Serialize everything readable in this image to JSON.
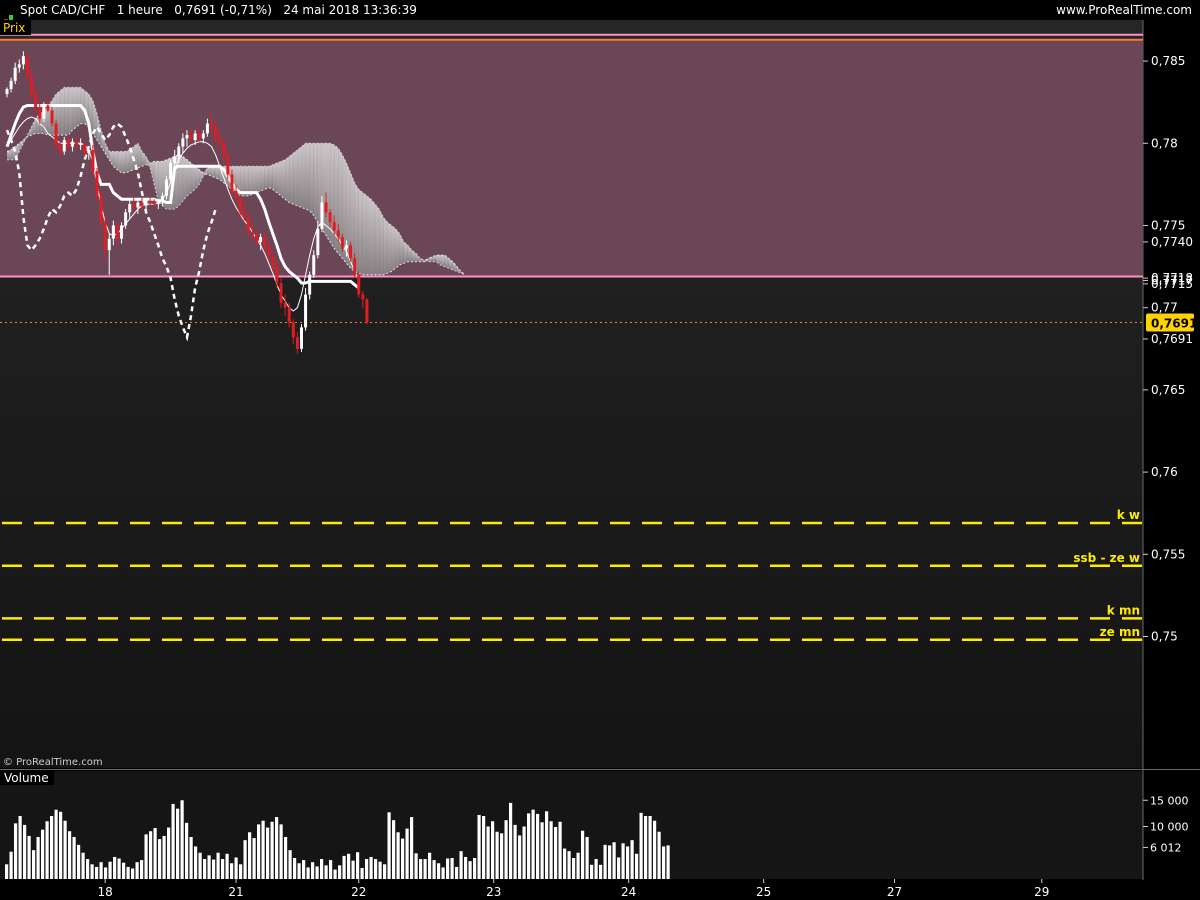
{
  "header": {
    "title": "Spot CAD/CHF   1 heure   0,7691 (-0,71%)   24 mai 2018 13:36:39",
    "site": "www.ProRealTime.com"
  },
  "panels": {
    "price_label": "Prix",
    "volume_label": "Volume",
    "watermark": "© ProRealTime.com"
  },
  "colors": {
    "up": "#ffffff",
    "down": "#e01c24",
    "zone_fill": "#6b4657",
    "orange": "#ff7a2a",
    "pink": "#ff8fc8",
    "yellow": "#ffea00",
    "last_price_bg": "#ffd200"
  },
  "chart_data": {
    "type": "candlestick",
    "instrument": "Spot CAD/CHF",
    "timeframe": "1 heure",
    "y_range": [
      0.742,
      0.7875
    ],
    "y_ticks": [
      "0,785",
      "0,78",
      "0,775",
      "0,77",
      "0,765",
      "0,76",
      "0,755",
      "0,75"
    ],
    "y_tick_values": [
      0.785,
      0.78,
      0.775,
      0.77,
      0.765,
      0.76,
      0.755,
      0.75
    ],
    "x_ticks": [
      "18",
      "21",
      "22",
      "23",
      "24",
      "25",
      "27",
      "29"
    ],
    "x_tick_index": [
      24,
      56,
      86,
      119,
      152,
      185,
      217,
      253
    ],
    "last_price": 0.7691,
    "last_price_label": "0,7691",
    "right_markers": [
      {
        "label": "0,7740",
        "value": 0.774
      },
      {
        "label": "0,7718",
        "value": 0.7718
      },
      {
        "label": "0,7717",
        "value": 0.77165
      },
      {
        "label": "0,7715",
        "value": 0.77145
      },
      {
        "label": "0,7691",
        "value": 0.7681
      }
    ],
    "zone": {
      "top": 0.7863,
      "bottom": 0.7719
    },
    "horizontal_lines": [
      {
        "value": 0.7877,
        "color": "orange",
        "style": "solid"
      },
      {
        "value": 0.7866,
        "color": "pink",
        "style": "solid"
      },
      {
        "value": 0.7863,
        "color": "orange",
        "style": "solid"
      },
      {
        "value": 0.7719,
        "color": "pink",
        "style": "solid"
      },
      {
        "value": 0.7691,
        "color": "orange",
        "style": "dotted"
      }
    ],
    "yellow_levels": [
      {
        "label": "k w",
        "value": 0.7569
      },
      {
        "label": "ssb - ze w",
        "value": 0.7543
      },
      {
        "label": "k mn",
        "value": 0.7511
      },
      {
        "label": "ze mn",
        "value": 0.7498
      }
    ],
    "ohlc": [
      [
        0.783,
        0.7834,
        0.7828,
        0.7833
      ],
      [
        0.7833,
        0.784,
        0.7831,
        0.7838
      ],
      [
        0.7838,
        0.7849,
        0.7836,
        0.7846
      ],
      [
        0.7846,
        0.7851,
        0.7843,
        0.7848
      ],
      [
        0.7848,
        0.7856,
        0.7845,
        0.7853
      ],
      [
        0.7853,
        0.7854,
        0.7838,
        0.7841
      ],
      [
        0.7841,
        0.7845,
        0.7827,
        0.783
      ],
      [
        0.783,
        0.7834,
        0.7818,
        0.7822
      ],
      [
        0.7822,
        0.7826,
        0.7812,
        0.7815
      ],
      [
        0.7815,
        0.7825,
        0.7813,
        0.7823
      ],
      [
        0.7823,
        0.7828,
        0.7819,
        0.782
      ],
      [
        0.782,
        0.7822,
        0.781,
        0.7812
      ],
      [
        0.7812,
        0.7814,
        0.7796,
        0.7799
      ],
      [
        0.7799,
        0.7802,
        0.7792,
        0.7795
      ],
      [
        0.7795,
        0.7804,
        0.7793,
        0.7802
      ],
      [
        0.7802,
        0.7806,
        0.7796,
        0.7798
      ],
      [
        0.7798,
        0.7803,
        0.7795,
        0.7801
      ],
      [
        0.7801,
        0.7804,
        0.7797,
        0.7799
      ],
      [
        0.7799,
        0.7803,
        0.7796,
        0.78
      ],
      [
        0.78,
        0.7801,
        0.7792,
        0.7794
      ],
      [
        0.7794,
        0.7798,
        0.779,
        0.7796
      ],
      [
        0.7796,
        0.7799,
        0.778,
        0.7783
      ],
      [
        0.7783,
        0.7785,
        0.7765,
        0.7768
      ],
      [
        0.7768,
        0.7771,
        0.7748,
        0.7752
      ],
      [
        0.7752,
        0.7756,
        0.773,
        0.7735
      ],
      [
        0.7735,
        0.7745,
        0.772,
        0.7742
      ],
      [
        0.7742,
        0.7753,
        0.7738,
        0.775
      ],
      [
        0.775,
        0.7752,
        0.7738,
        0.7742
      ],
      [
        0.7742,
        0.7752,
        0.7739,
        0.775
      ],
      [
        0.775,
        0.776,
        0.7748,
        0.7758
      ],
      [
        0.7758,
        0.7766,
        0.7754,
        0.7763
      ],
      [
        0.7763,
        0.7767,
        0.7758,
        0.7761
      ],
      [
        0.7761,
        0.7766,
        0.7757,
        0.7764
      ],
      [
        0.7764,
        0.7768,
        0.776,
        0.7762
      ],
      [
        0.7762,
        0.7766,
        0.7758,
        0.7765
      ],
      [
        0.7765,
        0.7768,
        0.7762,
        0.7764
      ],
      [
        0.7764,
        0.7766,
        0.7761,
        0.7763
      ],
      [
        0.7763,
        0.7765,
        0.776,
        0.7764
      ],
      [
        0.7764,
        0.777,
        0.7762,
        0.7768
      ],
      [
        0.7768,
        0.778,
        0.7766,
        0.7778
      ],
      [
        0.7778,
        0.779,
        0.7776,
        0.7788
      ],
      [
        0.7788,
        0.7796,
        0.7785,
        0.7792
      ],
      [
        0.7792,
        0.78,
        0.7788,
        0.7798
      ],
      [
        0.7798,
        0.7806,
        0.7794,
        0.7803
      ],
      [
        0.7803,
        0.7808,
        0.7798,
        0.7805
      ],
      [
        0.7805,
        0.781,
        0.78,
        0.7802
      ],
      [
        0.7802,
        0.7808,
        0.7799,
        0.7806
      ],
      [
        0.7806,
        0.781,
        0.7801,
        0.7803
      ],
      [
        0.7803,
        0.7808,
        0.78,
        0.7806
      ],
      [
        0.7806,
        0.7815,
        0.7804,
        0.7812
      ],
      [
        0.7812,
        0.782,
        0.7806,
        0.781
      ],
      [
        0.781,
        0.7814,
        0.78,
        0.7803
      ],
      [
        0.7803,
        0.7808,
        0.7797,
        0.78
      ],
      [
        0.78,
        0.7803,
        0.7789,
        0.7792
      ],
      [
        0.7792,
        0.7795,
        0.7778,
        0.7781
      ],
      [
        0.7781,
        0.7784,
        0.7768,
        0.7771
      ],
      [
        0.7771,
        0.7775,
        0.7764,
        0.7767
      ],
      [
        0.7767,
        0.7769,
        0.7755,
        0.7758
      ],
      [
        0.7758,
        0.7764,
        0.7753,
        0.7755
      ],
      [
        0.7755,
        0.7758,
        0.7743,
        0.7746
      ],
      [
        0.7746,
        0.7752,
        0.7742,
        0.7744
      ],
      [
        0.7744,
        0.7748,
        0.7738,
        0.774
      ],
      [
        0.774,
        0.7745,
        0.7735,
        0.7743
      ],
      [
        0.7743,
        0.7746,
        0.7734,
        0.7737
      ],
      [
        0.7737,
        0.774,
        0.7729,
        0.7731
      ],
      [
        0.7731,
        0.7734,
        0.7722,
        0.7725
      ],
      [
        0.7725,
        0.7729,
        0.7712,
        0.7715
      ],
      [
        0.7715,
        0.7718,
        0.77,
        0.7703
      ],
      [
        0.7703,
        0.7708,
        0.7695,
        0.77
      ],
      [
        0.77,
        0.7703,
        0.7688,
        0.7691
      ],
      [
        0.7691,
        0.7693,
        0.7678,
        0.7682
      ],
      [
        0.7682,
        0.7685,
        0.7672,
        0.7675
      ],
      [
        0.7675,
        0.769,
        0.7673,
        0.7688
      ],
      [
        0.7688,
        0.7712,
        0.7686,
        0.7708
      ],
      [
        0.7708,
        0.7722,
        0.7705,
        0.772
      ],
      [
        0.772,
        0.7735,
        0.7718,
        0.7732
      ],
      [
        0.7732,
        0.7752,
        0.773,
        0.7748
      ],
      [
        0.7748,
        0.7768,
        0.7746,
        0.7764
      ],
      [
        0.7764,
        0.777,
        0.7755,
        0.7758
      ],
      [
        0.7758,
        0.776,
        0.7749,
        0.7752
      ],
      [
        0.7752,
        0.7756,
        0.7744,
        0.7747
      ],
      [
        0.7747,
        0.7751,
        0.774,
        0.7743
      ],
      [
        0.7743,
        0.7745,
        0.7734,
        0.7736
      ],
      [
        0.7736,
        0.7741,
        0.7731,
        0.7738
      ],
      [
        0.7738,
        0.774,
        0.7728,
        0.773
      ],
      [
        0.773,
        0.7733,
        0.7718,
        0.772
      ],
      [
        0.772,
        0.7722,
        0.7706,
        0.7708
      ],
      [
        0.7708,
        0.771,
        0.77,
        0.7705
      ],
      [
        0.7705,
        0.7706,
        0.769,
        0.7691
      ]
    ],
    "tenkan": [
      0.7798,
      0.7802,
      0.7806,
      0.781,
      0.7813,
      0.7815,
      0.7816,
      0.7815,
      0.7812,
      0.781,
      0.7806,
      0.7804,
      0.7802,
      0.78,
      0.78,
      0.78,
      0.78,
      0.78,
      0.78,
      0.7799,
      0.7796,
      0.7788,
      0.7775,
      0.7762,
      0.7752,
      0.7745,
      0.7744,
      0.7745,
      0.7748,
      0.7751,
      0.7754,
      0.7757,
      0.776,
      0.7762,
      0.7763,
      0.7763,
      0.7763,
      0.7764,
      0.7766,
      0.777,
      0.7776,
      0.7784,
      0.779,
      0.7794,
      0.7797,
      0.7799,
      0.78,
      0.7801,
      0.7801,
      0.78,
      0.7798,
      0.7793,
      0.7786,
      0.7779,
      0.7772,
      0.7766,
      0.7761,
      0.7757,
      0.7753,
      0.775,
      0.7746,
      0.7742,
      0.7738,
      0.7733,
      0.7727,
      0.7721,
      0.7714,
      0.7708,
      0.7704,
      0.77,
      0.7698,
      0.77,
      0.7708,
      0.772,
      0.7732,
      0.7742,
      0.7749,
      0.7752,
      0.775,
      0.7748,
      0.7745,
      0.7742,
      0.7738,
      0.7734,
      0.7728,
      0.7722,
      0.7718
    ],
    "kijun": [
      0.7798,
      0.7805,
      0.7812,
      0.7818,
      0.7822,
      0.7823,
      0.7823,
      0.7823,
      0.7823,
      0.7823,
      0.7823,
      0.7823,
      0.7823,
      0.7823,
      0.7823,
      0.7823,
      0.7823,
      0.7823,
      0.7823,
      0.782,
      0.7812,
      0.7795,
      0.7782,
      0.7775,
      0.7775,
      0.7775,
      0.777,
      0.7768,
      0.7766,
      0.7766,
      0.7766,
      0.7766,
      0.7766,
      0.7766,
      0.7766,
      0.7766,
      0.7766,
      0.7765,
      0.7765,
      0.7764,
      0.7764,
      0.7785,
      0.7786,
      0.7786,
      0.7786,
      0.7786,
      0.7786,
      0.7786,
      0.7786,
      0.7786,
      0.7786,
      0.7786,
      0.7786,
      0.7784,
      0.778,
      0.7776,
      0.7772,
      0.777,
      0.777,
      0.777,
      0.777,
      0.777,
      0.7766,
      0.776,
      0.7752,
      0.7745,
      0.7738,
      0.773,
      0.7725,
      0.7722,
      0.772,
      0.7718,
      0.7715,
      0.7715,
      0.7716,
      0.7716,
      0.7716,
      0.7716,
      0.7716,
      0.7716,
      0.7716,
      0.7716,
      0.7716,
      0.7716,
      0.7716,
      0.7714,
      0.7712
    ],
    "chikou": [
      0.7808,
      0.7802,
      0.7795,
      0.7782,
      0.7755,
      0.7738,
      0.7735,
      0.7738,
      0.7742,
      0.7748,
      0.7755,
      0.776,
      0.7758,
      0.7762,
      0.7768,
      0.777,
      0.7768,
      0.7772,
      0.778,
      0.779,
      0.7798,
      0.7806,
      0.781,
      0.7806,
      0.7802,
      0.7805,
      0.781,
      0.7812,
      0.781,
      0.7804,
      0.7798,
      0.779,
      0.7782,
      0.777,
      0.7758,
      0.7752,
      0.7745,
      0.7738,
      0.773,
      0.7725,
      0.7718,
      0.7705,
      0.7695,
      0.7688,
      0.7682,
      0.7695,
      0.7712,
      0.7722,
      0.7735,
      0.7745,
      0.7752,
      0.776
    ],
    "span_a": [
      0.7795,
      0.7796,
      0.7798,
      0.78,
      0.7802,
      0.7804,
      0.7805,
      0.7806,
      0.7806,
      0.7806,
      0.7805,
      0.7805,
      0.7805,
      0.7805,
      0.7805,
      0.7805,
      0.7808,
      0.781,
      0.7812,
      0.7812,
      0.781,
      0.7806,
      0.7802,
      0.7798,
      0.7794,
      0.779,
      0.7786,
      0.7784,
      0.7782,
      0.7782,
      0.7783,
      0.7784,
      0.7785,
      0.7786,
      0.7787,
      0.7788,
      0.7789,
      0.7789,
      0.7789,
      0.779,
      0.7791,
      0.7792,
      0.7793,
      0.7792,
      0.779,
      0.7788,
      0.7786,
      0.7784,
      0.7782,
      0.7781,
      0.778,
      0.7779,
      0.7778,
      0.7776,
      0.7774,
      0.7772,
      0.777,
      0.7768,
      0.7768,
      0.7768,
      0.7769,
      0.777,
      0.7771,
      0.7772,
      0.7773,
      0.7772,
      0.777,
      0.7768,
      0.7766,
      0.7764,
      0.7763,
      0.7762,
      0.7761,
      0.776,
      0.7759,
      0.7756,
      0.7752,
      0.7748,
      0.7744,
      0.774,
      0.7736,
      0.7733,
      0.773,
      0.7727,
      0.7724,
      0.7722,
      0.7721,
      0.772,
      0.772,
      0.772,
      0.772,
      0.772,
      0.772,
      0.7721,
      0.7722,
      0.7724,
      0.7726,
      0.7727,
      0.7728,
      0.7728,
      0.7728,
      0.7728,
      0.7728,
      0.773,
      0.7731,
      0.7732,
      0.7732,
      0.7732,
      0.773,
      0.7728,
      0.7725,
      0.7722,
      0.772
    ],
    "span_b": [
      0.779,
      0.779,
      0.779,
      0.7795,
      0.78,
      0.7805,
      0.781,
      0.7815,
      0.7818,
      0.782,
      0.7822,
      0.7826,
      0.783,
      0.7832,
      0.7834,
      0.7834,
      0.7834,
      0.7834,
      0.7834,
      0.7832,
      0.783,
      0.7826,
      0.7818,
      0.7808,
      0.78,
      0.7795,
      0.7795,
      0.7795,
      0.7795,
      0.7795,
      0.7796,
      0.7798,
      0.78,
      0.7795,
      0.7792,
      0.7785,
      0.7775,
      0.7765,
      0.7762,
      0.776,
      0.776,
      0.776,
      0.7762,
      0.7765,
      0.7768,
      0.777,
      0.7772,
      0.7775,
      0.778,
      0.7785,
      0.7786,
      0.7786,
      0.7786,
      0.7786,
      0.7786,
      0.7786,
      0.7786,
      0.7786,
      0.7786,
      0.7786,
      0.7786,
      0.7786,
      0.7786,
      0.7786,
      0.7786,
      0.7787,
      0.7788,
      0.7789,
      0.779,
      0.7792,
      0.7794,
      0.7796,
      0.7798,
      0.78,
      0.78,
      0.78,
      0.78,
      0.78,
      0.78,
      0.78,
      0.7799,
      0.7797,
      0.7793,
      0.7788,
      0.7782,
      0.7776,
      0.7772,
      0.777,
      0.7768,
      0.7766,
      0.7763,
      0.776,
      0.7755,
      0.7752,
      0.775,
      0.7748,
      0.7745,
      0.774,
      0.7738,
      0.7735,
      0.7733,
      0.773,
      0.7729,
      0.7728,
      0.7728,
      0.7728,
      0.7726,
      0.7725,
      0.7724,
      0.7723,
      0.7722,
      0.7721,
      0.772
    ],
    "volume": {
      "y_range": [
        0,
        16000
      ],
      "y_ticks": [
        "15 000",
        "10 000",
        "6 012"
      ],
      "y_tick_values": [
        15000,
        10000,
        6012
      ],
      "values": [
        2800,
        5200,
        10600,
        12000,
        10300,
        8200,
        5500,
        8000,
        9400,
        11000,
        12000,
        13200,
        12800,
        11100,
        9100,
        8000,
        6500,
        5000,
        3800,
        2800,
        2300,
        3200,
        2200,
        3300,
        4200,
        3900,
        3100,
        2300,
        2000,
        3200,
        3600,
        8500,
        9100,
        9700,
        7600,
        8200,
        9800,
        14300,
        13400,
        15000,
        10700,
        8000,
        6200,
        5000,
        3800,
        4500,
        3700,
        5000,
        3800,
        4800,
        3000,
        4100,
        2800,
        7400,
        8900,
        7800,
        10400,
        11100,
        9800,
        10900,
        11800,
        10400,
        8000,
        5500,
        4000,
        3000,
        3600,
        2200,
        3200,
        2400,
        3800,
        2600,
        3600,
        1800,
        2600,
        4400,
        4800,
        3500,
        5100,
        2100,
        3800,
        4200,
        3800,
        3300,
        2800,
        12700,
        11200,
        8900,
        7700,
        9600,
        11800,
        4900,
        3800,
        3800,
        5000,
        3600,
        3000,
        2200,
        3900,
        4000,
        2300,
        5300,
        4200,
        3400,
        4000,
        12200,
        12000,
        10000,
        11000,
        9000,
        8700,
        11200,
        14500,
        10300,
        8300,
        10000,
        12500,
        13200,
        12400,
        10800,
        12900,
        11000,
        9900,
        10900,
        5800,
        5300,
        4000,
        5000,
        9200,
        8000,
        2700,
        3800,
        2700,
        6500,
        6400,
        7000,
        4100,
        6800,
        6200,
        7400,
        4800,
        12600,
        12000,
        12000,
        11100,
        9000,
        6200,
        6400
      ]
    }
  }
}
